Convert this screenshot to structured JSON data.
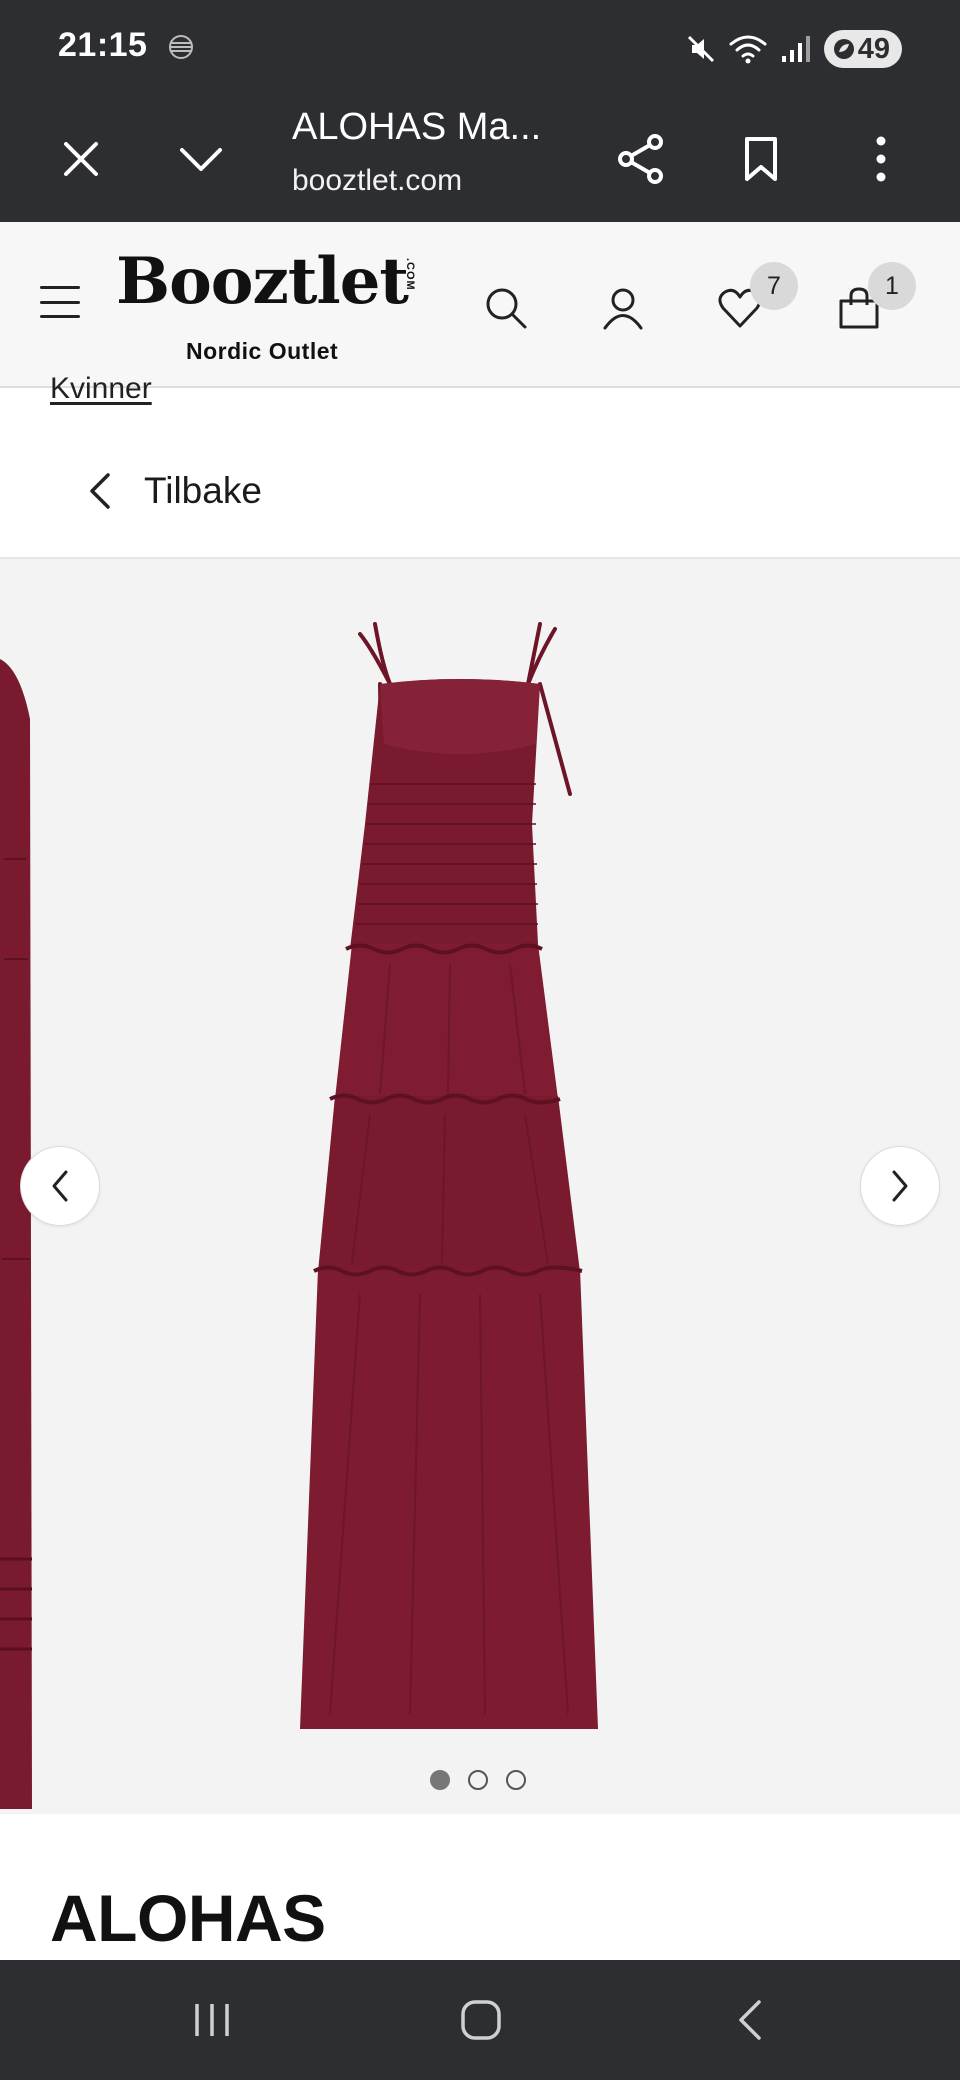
{
  "status_bar": {
    "time": "21:15",
    "battery": "49",
    "icons": [
      "data-saver-icon",
      "mute-icon",
      "wifi-icon",
      "signal-icon",
      "battery-icon"
    ]
  },
  "custom_tab": {
    "title": "ALOHAS Ma...",
    "url": "booztlet.com",
    "icons": [
      "close-icon",
      "chevron-down-icon",
      "share-icon",
      "bookmark-icon",
      "more-vert-icon"
    ]
  },
  "header": {
    "logo_main": "Booztlet",
    "logo_com": ".COM",
    "logo_sub": "Nordic Outlet",
    "wishlist_count": "7",
    "cart_count": "1",
    "icons": [
      "menu-icon",
      "search-icon",
      "account-icon",
      "heart-icon",
      "bag-icon"
    ]
  },
  "breadcrumb": {
    "current": "Kvinner"
  },
  "back": {
    "label": "Tilbake"
  },
  "gallery": {
    "total_images": 3,
    "active_index": 0,
    "product_color": "#7a1a2e",
    "icons": [
      "chevron-left-icon",
      "chevron-right-icon"
    ]
  },
  "product": {
    "brand": "ALOHAS"
  },
  "nav_bar": {
    "icons": [
      "recents-icon",
      "home-icon",
      "back-icon"
    ]
  }
}
